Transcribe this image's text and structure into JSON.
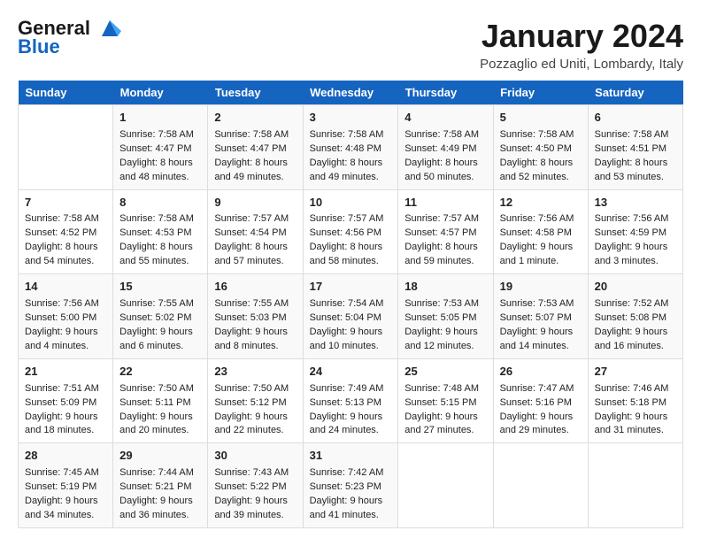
{
  "header": {
    "logo_line1": "General",
    "logo_line2": "Blue",
    "month_title": "January 2024",
    "location": "Pozzaglio ed Uniti, Lombardy, Italy"
  },
  "days_of_week": [
    "Sunday",
    "Monday",
    "Tuesday",
    "Wednesday",
    "Thursday",
    "Friday",
    "Saturday"
  ],
  "weeks": [
    [
      {
        "day": "",
        "sunrise": "",
        "sunset": "",
        "daylight": ""
      },
      {
        "day": "1",
        "sunrise": "Sunrise: 7:58 AM",
        "sunset": "Sunset: 4:47 PM",
        "daylight": "Daylight: 8 hours and 48 minutes."
      },
      {
        "day": "2",
        "sunrise": "Sunrise: 7:58 AM",
        "sunset": "Sunset: 4:47 PM",
        "daylight": "Daylight: 8 hours and 49 minutes."
      },
      {
        "day": "3",
        "sunrise": "Sunrise: 7:58 AM",
        "sunset": "Sunset: 4:48 PM",
        "daylight": "Daylight: 8 hours and 49 minutes."
      },
      {
        "day": "4",
        "sunrise": "Sunrise: 7:58 AM",
        "sunset": "Sunset: 4:49 PM",
        "daylight": "Daylight: 8 hours and 50 minutes."
      },
      {
        "day": "5",
        "sunrise": "Sunrise: 7:58 AM",
        "sunset": "Sunset: 4:50 PM",
        "daylight": "Daylight: 8 hours and 52 minutes."
      },
      {
        "day": "6",
        "sunrise": "Sunrise: 7:58 AM",
        "sunset": "Sunset: 4:51 PM",
        "daylight": "Daylight: 8 hours and 53 minutes."
      }
    ],
    [
      {
        "day": "7",
        "sunrise": "Sunrise: 7:58 AM",
        "sunset": "Sunset: 4:52 PM",
        "daylight": "Daylight: 8 hours and 54 minutes."
      },
      {
        "day": "8",
        "sunrise": "Sunrise: 7:58 AM",
        "sunset": "Sunset: 4:53 PM",
        "daylight": "Daylight: 8 hours and 55 minutes."
      },
      {
        "day": "9",
        "sunrise": "Sunrise: 7:57 AM",
        "sunset": "Sunset: 4:54 PM",
        "daylight": "Daylight: 8 hours and 57 minutes."
      },
      {
        "day": "10",
        "sunrise": "Sunrise: 7:57 AM",
        "sunset": "Sunset: 4:56 PM",
        "daylight": "Daylight: 8 hours and 58 minutes."
      },
      {
        "day": "11",
        "sunrise": "Sunrise: 7:57 AM",
        "sunset": "Sunset: 4:57 PM",
        "daylight": "Daylight: 8 hours and 59 minutes."
      },
      {
        "day": "12",
        "sunrise": "Sunrise: 7:56 AM",
        "sunset": "Sunset: 4:58 PM",
        "daylight": "Daylight: 9 hours and 1 minute."
      },
      {
        "day": "13",
        "sunrise": "Sunrise: 7:56 AM",
        "sunset": "Sunset: 4:59 PM",
        "daylight": "Daylight: 9 hours and 3 minutes."
      }
    ],
    [
      {
        "day": "14",
        "sunrise": "Sunrise: 7:56 AM",
        "sunset": "Sunset: 5:00 PM",
        "daylight": "Daylight: 9 hours and 4 minutes."
      },
      {
        "day": "15",
        "sunrise": "Sunrise: 7:55 AM",
        "sunset": "Sunset: 5:02 PM",
        "daylight": "Daylight: 9 hours and 6 minutes."
      },
      {
        "day": "16",
        "sunrise": "Sunrise: 7:55 AM",
        "sunset": "Sunset: 5:03 PM",
        "daylight": "Daylight: 9 hours and 8 minutes."
      },
      {
        "day": "17",
        "sunrise": "Sunrise: 7:54 AM",
        "sunset": "Sunset: 5:04 PM",
        "daylight": "Daylight: 9 hours and 10 minutes."
      },
      {
        "day": "18",
        "sunrise": "Sunrise: 7:53 AM",
        "sunset": "Sunset: 5:05 PM",
        "daylight": "Daylight: 9 hours and 12 minutes."
      },
      {
        "day": "19",
        "sunrise": "Sunrise: 7:53 AM",
        "sunset": "Sunset: 5:07 PM",
        "daylight": "Daylight: 9 hours and 14 minutes."
      },
      {
        "day": "20",
        "sunrise": "Sunrise: 7:52 AM",
        "sunset": "Sunset: 5:08 PM",
        "daylight": "Daylight: 9 hours and 16 minutes."
      }
    ],
    [
      {
        "day": "21",
        "sunrise": "Sunrise: 7:51 AM",
        "sunset": "Sunset: 5:09 PM",
        "daylight": "Daylight: 9 hours and 18 minutes."
      },
      {
        "day": "22",
        "sunrise": "Sunrise: 7:50 AM",
        "sunset": "Sunset: 5:11 PM",
        "daylight": "Daylight: 9 hours and 20 minutes."
      },
      {
        "day": "23",
        "sunrise": "Sunrise: 7:50 AM",
        "sunset": "Sunset: 5:12 PM",
        "daylight": "Daylight: 9 hours and 22 minutes."
      },
      {
        "day": "24",
        "sunrise": "Sunrise: 7:49 AM",
        "sunset": "Sunset: 5:13 PM",
        "daylight": "Daylight: 9 hours and 24 minutes."
      },
      {
        "day": "25",
        "sunrise": "Sunrise: 7:48 AM",
        "sunset": "Sunset: 5:15 PM",
        "daylight": "Daylight: 9 hours and 27 minutes."
      },
      {
        "day": "26",
        "sunrise": "Sunrise: 7:47 AM",
        "sunset": "Sunset: 5:16 PM",
        "daylight": "Daylight: 9 hours and 29 minutes."
      },
      {
        "day": "27",
        "sunrise": "Sunrise: 7:46 AM",
        "sunset": "Sunset: 5:18 PM",
        "daylight": "Daylight: 9 hours and 31 minutes."
      }
    ],
    [
      {
        "day": "28",
        "sunrise": "Sunrise: 7:45 AM",
        "sunset": "Sunset: 5:19 PM",
        "daylight": "Daylight: 9 hours and 34 minutes."
      },
      {
        "day": "29",
        "sunrise": "Sunrise: 7:44 AM",
        "sunset": "Sunset: 5:21 PM",
        "daylight": "Daylight: 9 hours and 36 minutes."
      },
      {
        "day": "30",
        "sunrise": "Sunrise: 7:43 AM",
        "sunset": "Sunset: 5:22 PM",
        "daylight": "Daylight: 9 hours and 39 minutes."
      },
      {
        "day": "31",
        "sunrise": "Sunrise: 7:42 AM",
        "sunset": "Sunset: 5:23 PM",
        "daylight": "Daylight: 9 hours and 41 minutes."
      },
      {
        "day": "",
        "sunrise": "",
        "sunset": "",
        "daylight": ""
      },
      {
        "day": "",
        "sunrise": "",
        "sunset": "",
        "daylight": ""
      },
      {
        "day": "",
        "sunrise": "",
        "sunset": "",
        "daylight": ""
      }
    ]
  ]
}
